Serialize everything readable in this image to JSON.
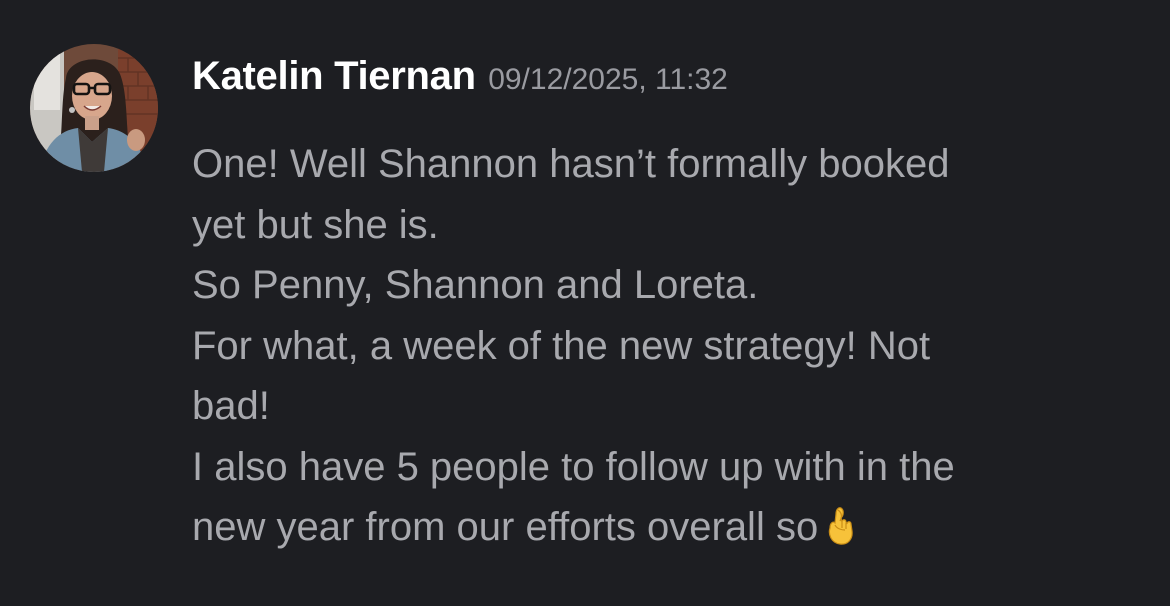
{
  "message": {
    "author": "Katelin Tiernan",
    "timestamp": "09/12/2025, 11:32",
    "avatar_icon": "user-avatar-photo",
    "lines": [
      "One! Well Shannon hasn’t formally booked",
      "yet but she is.",
      "So Penny, Shannon and Loreta.",
      "For what, a week of the new strategy! Not",
      "bad!",
      "I also have 5 people to follow up with in the",
      "new year from our efforts overall so"
    ],
    "trailing_emoji": "crossed-fingers-icon"
  },
  "colors": {
    "background": "#1d1e22",
    "author": "#ffffff",
    "timestamp": "#9a9ba1",
    "body_text": "#a8a9ae"
  }
}
